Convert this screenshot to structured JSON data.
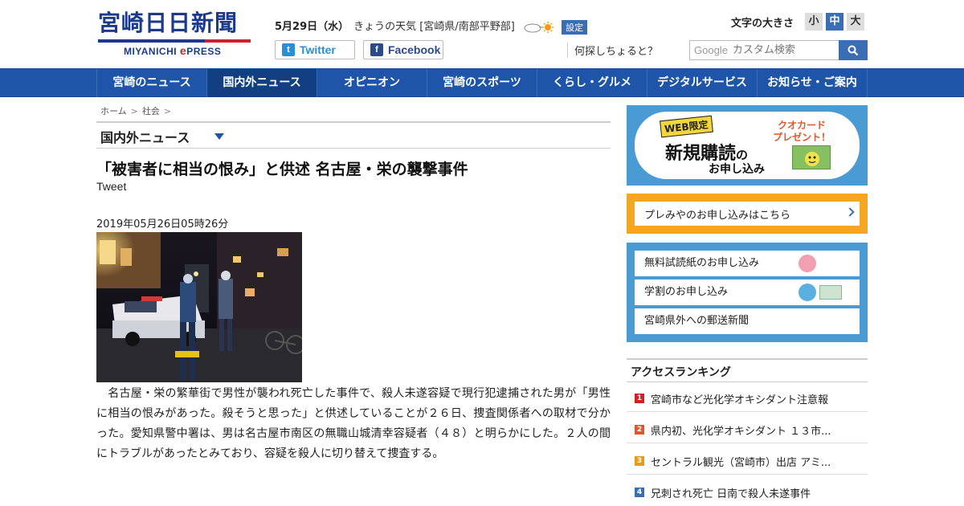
{
  "header": {
    "logo_main": "宮崎日日新聞",
    "logo_sub_left": "MIYANICHI ",
    "logo_sub_e": "e",
    "logo_sub_right": "PRESS",
    "date": "5月29日（水）",
    "weather_label": "きょうの天気 [宮崎県/南部平野部]",
    "weather_icon": "cloudy-sunny-icon",
    "setting_label": "設定",
    "twitter_label": "Twitter",
    "facebook_label": "Facebook",
    "fontsize_label": "文字の大きさ",
    "fontsize_options": [
      "小",
      "中",
      "大"
    ],
    "fontsize_selected": "中",
    "search_question": "何探しちょると？",
    "search_brand": "Google",
    "search_placeholder": "カスタム検索"
  },
  "nav": {
    "items": [
      "宮崎のニュース",
      "国内外ニュース",
      "オピニオン",
      "宮崎のスポーツ",
      "くらし・グルメ",
      "デジタルサービス",
      "お知らせ・ご案内"
    ],
    "active": "国内外ニュース"
  },
  "breadcrumb": [
    "ホーム",
    "社会"
  ],
  "section_title": "国内外ニュース",
  "article": {
    "title": "「被害者に相当の恨み」と供述 名古屋・栄の襲撃事件",
    "tweet": "Tweet",
    "date": "2019年05月26日05時26分",
    "body": "　名古屋・栄の繁華街で男性が襲われ死亡した事件で、殺人未遂容疑で現行犯逮捕された男が「男性に相当の恨みがあった。殺そうと思った」と供述していることが２６日、捜査関係者への取材で分かった。愛知県警中署は、男は名古屋市南区の無職山城清幸容疑者（４８）と明らかにした。２人の間にトラブルがあったとみており、容疑を殺人に切り替えて捜査する。"
  },
  "sidebar": {
    "promo1": {
      "badge": "WEB限定",
      "big": "新規購読",
      "big_suffix": "の",
      "sub": "お申し込み",
      "quo_line1": "クオカード",
      "quo_line2": "プレゼント！"
    },
    "promo2_label": "プレみやのお申し込みはこちら",
    "promo3_items": [
      "無料試読紙のお申し込み",
      "学割のお申し込み",
      "宮崎県外への郵送新聞"
    ],
    "ranking_title": "アクセスランキング",
    "ranking": [
      {
        "num": "1",
        "text": "宮崎市など光化学オキシダント注意報",
        "color": "#d0202a"
      },
      {
        "num": "2",
        "text": "県内初、光化学オキシダント １３市...",
        "color": "#e2572a"
      },
      {
        "num": "3",
        "text": "セントラル観光（宮崎市）出店 アミ...",
        "color": "#e89a1a"
      },
      {
        "num": "4",
        "text": "兄刺され死亡 日南で殺人未遂事件",
        "color": "#3a6eb4"
      }
    ]
  },
  "colors": {
    "brand_blue": "#1e55a8",
    "accent_red": "#d0202a",
    "promo_orange": "#f5a623",
    "promo_blue": "#4a9ad4"
  }
}
